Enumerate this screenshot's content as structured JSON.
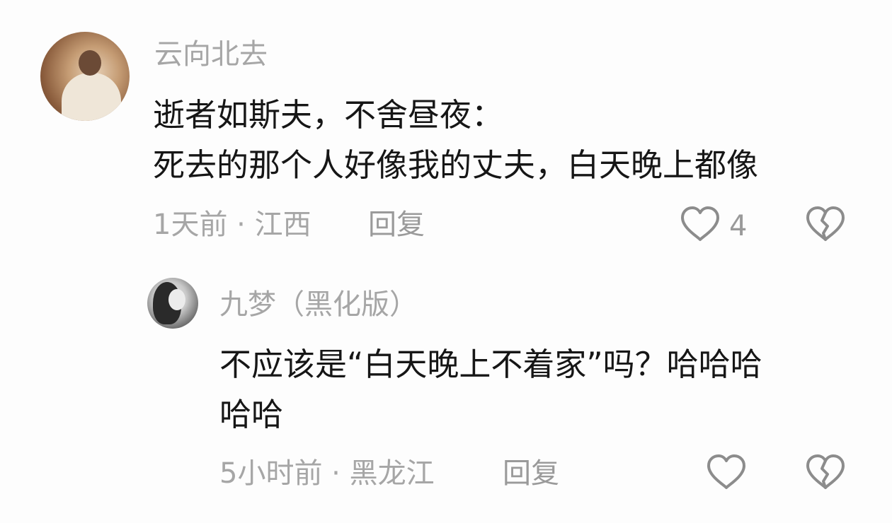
{
  "comments": [
    {
      "username": "云向北去",
      "content_lines": [
        "逝者如斯夫，不舍昼夜：",
        "死去的那个人好像我的丈夫，白天晚上都像"
      ],
      "meta": "1天前 · 江西",
      "reply_label": "回复",
      "like_count": "4"
    },
    {
      "username": "九梦（黑化版）",
      "content_lines": [
        "不应该是“白天晚上不着家”吗？哈哈哈",
        "哈哈"
      ],
      "meta": "5小时前 · 黑龙江",
      "reply_label": "回复",
      "like_count": ""
    }
  ],
  "icons": {
    "like": "heart-outline-icon",
    "dislike": "broken-heart-icon"
  },
  "colors": {
    "background": "#fdfdfd",
    "text": "#161616",
    "secondary": "#a6a6a6",
    "icon": "#8c8c8c"
  }
}
